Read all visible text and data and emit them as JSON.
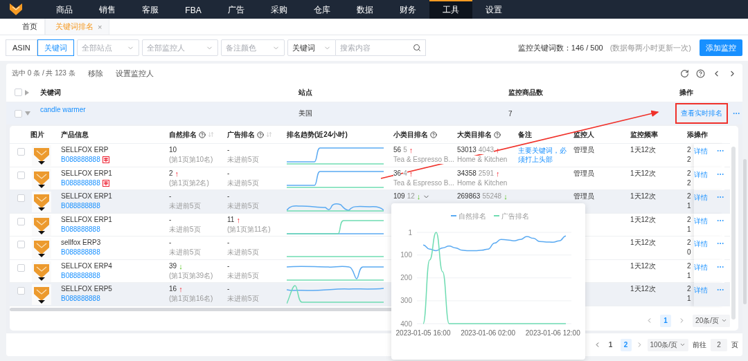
{
  "nav": {
    "items": [
      {
        "label": "商品",
        "selected": false
      },
      {
        "label": "销售",
        "selected": false
      },
      {
        "label": "客服",
        "selected": false
      },
      {
        "label": "FBA",
        "selected": false
      },
      {
        "label": "广告",
        "selected": false
      },
      {
        "label": "采购",
        "selected": false
      },
      {
        "label": "仓库",
        "selected": false
      },
      {
        "label": "数据",
        "selected": false
      },
      {
        "label": "财务",
        "selected": false
      },
      {
        "label": "工具",
        "selected": true
      },
      {
        "label": "设置",
        "selected": false
      }
    ]
  },
  "page_tabs": [
    {
      "label": "首页",
      "selected": false
    },
    {
      "label": "关键词排名",
      "selected": true,
      "close": "×"
    }
  ],
  "filters": {
    "mode_tabs": [
      {
        "label": "ASIN",
        "selected": false
      },
      {
        "label": "关键词",
        "selected": true
      }
    ],
    "selects": [
      {
        "placeholder": "全部站点"
      },
      {
        "placeholder": "全部监控人"
      },
      {
        "placeholder": "备注颜色"
      }
    ],
    "search_type": "关键词",
    "search": {
      "placeholder": "搜索内容"
    },
    "count_label": "监控关键词数：146 / 500",
    "update_note": "(数据每两小时更新一次)",
    "add_button": "添加监控"
  },
  "toolbar": {
    "selection": "选中 0 条 / 共 123 条",
    "actions": [
      "移除",
      "设置监控人"
    ]
  },
  "keyword_table": {
    "select_all": {
      "checked": false
    },
    "columns": [
      "关键词",
      "站点",
      "监控商品数",
      "操作"
    ],
    "rows": [
      {
        "checked": false,
        "keyword": "candle warmer",
        "site": "美国",
        "count": "7",
        "action": "查看实时排名",
        "expanded": true,
        "highlighted": true
      }
    ]
  },
  "product_table": {
    "columns": [
      {
        "label": "图片",
        "help": false,
        "sortable": false
      },
      {
        "label": "产品信息",
        "help": false,
        "sortable": false
      },
      {
        "label": "自然排名",
        "help": true,
        "sortable": true
      },
      {
        "label": "广告排名",
        "help": true,
        "sortable": true
      },
      {
        "label": "排名趋势(近24小时)",
        "help": false,
        "sortable": false
      },
      {
        "label": "小类目排名",
        "help": true,
        "sortable": false
      },
      {
        "label": "大类目排名",
        "help": true,
        "sortable": false
      },
      {
        "label": "备注",
        "help": false,
        "sortable": false
      },
      {
        "label": "监控人",
        "help": false,
        "sortable": false
      },
      {
        "label": "监控频率",
        "help": false,
        "sortable": false
      },
      {
        "label": "添"
      },
      {
        "label": "操作",
        "help": false,
        "sortable": false
      }
    ],
    "rows": [
      {
        "checked": false,
        "hovered": false,
        "name": "SELLFOX ERP",
        "asin": "B088888888",
        "stamped": true,
        "natural": {
          "value": "10",
          "note": "(第1页第10名)"
        },
        "ad": {
          "value": "-",
          "note": "未进前5页"
        },
        "small": {
          "rank": "56",
          "change": "5",
          "arrow": "↑",
          "rising": true,
          "category": "Tea & Espresso B..."
        },
        "big": {
          "rank": "53013",
          "change": "4043",
          "arrow": "↑",
          "rising": true,
          "category": "Home & Kitchen"
        },
        "note": "主要关键词，必须打上头部",
        "monitor": "管理员",
        "frequency": "1天12次",
        "added": [
          "2",
          "2"
        ],
        "action": "详情"
      },
      {
        "checked": false,
        "hovered": false,
        "name": "SELLFOX ERP1",
        "asin": "B088888888",
        "stamped": true,
        "natural": {
          "value": "2",
          "arrow": "↑",
          "rising": true,
          "note": "(第1页第2名)"
        },
        "ad": {
          "value": "-",
          "note": "未进前5页"
        },
        "small": {
          "rank": "36",
          "change": "4",
          "arrow": "↑",
          "rising": true,
          "category": "Tea & Espresso B..."
        },
        "big": {
          "rank": "34358",
          "change": "2591",
          "arrow": "↑",
          "rising": true,
          "category": "Home & Kitchen"
        },
        "monitor": "管理员",
        "frequency": "1天12次",
        "added": [
          "2",
          "2"
        ],
        "action": "详情"
      },
      {
        "checked": false,
        "hovered": true,
        "name": "SELLFOX ERP1",
        "asin": "B088888888",
        "stamped": false,
        "natural": {
          "value": "-",
          "note": "未进前5页"
        },
        "ad": {
          "value": "-",
          "note": "未进前5页"
        },
        "small": {
          "rank": "109",
          "change": "12",
          "arrow": "↓",
          "rising": false,
          "expandable": true
        },
        "big": {
          "rank": "269863",
          "change": "55248",
          "arrow": "↓",
          "rising": false
        },
        "monitor": "管理员",
        "frequency": "1天12次",
        "added": [
          "2",
          "1"
        ],
        "action": "详情"
      },
      {
        "checked": false,
        "hovered": false,
        "name": "SELLFOX ERP1",
        "asin": "B088888888",
        "stamped": false,
        "natural": {
          "value": "-",
          "note": "未进前5页"
        },
        "ad": {
          "value": "11",
          "arrow": "↑",
          "rising": true,
          "note": "(第1页第11名)"
        },
        "frequency": "1天12次",
        "added": [
          "2",
          "1"
        ],
        "action": "详情"
      },
      {
        "checked": false,
        "hovered": false,
        "name": "sellfox ERP3",
        "asin": "B088888888",
        "stamped": false,
        "natural": {
          "value": "-",
          "note": "未进前5页"
        },
        "ad": {
          "value": "-",
          "note": "未进前5页"
        },
        "frequency": "1天12次",
        "added": [
          "2",
          "0"
        ],
        "action": "详情"
      },
      {
        "checked": false,
        "hovered": false,
        "name": "SELLFOX ERP4",
        "asin": "B088888888",
        "stamped": false,
        "natural": {
          "value": "39",
          "arrow": "↓",
          "rising": false,
          "note": "(第1页第39名)"
        },
        "ad": {
          "value": "-",
          "note": "未进前5页"
        },
        "frequency": "1天12次",
        "added": [
          "2",
          "1"
        ],
        "action": "详情"
      },
      {
        "checked": false,
        "hovered": true,
        "name": "SELLFOX ERP5",
        "asin": "B088888888",
        "stamped": false,
        "natural": {
          "value": "16",
          "arrow": "↑",
          "rising": true,
          "note": "(第1页第16名)"
        },
        "ad": {
          "value": "-",
          "note": "未进前5页"
        },
        "frequency": "1天12次",
        "added": [
          "2",
          "1"
        ],
        "action": "详情"
      }
    ],
    "pagination": {
      "pages": [
        {
          "label": "1",
          "selected": true
        }
      ],
      "page_size": "20条/页"
    }
  },
  "chart_popover": {
    "chart_data": {
      "type": "line",
      "grid": true,
      "legend": "top",
      "categories": [
        "2023-01-05 16:00",
        null,
        null,
        null,
        null,
        null,
        null,
        null,
        null,
        null,
        "2023-01-06 02:00",
        null,
        null,
        null,
        null,
        null,
        null,
        null,
        null,
        null,
        "2023-01-06 12:00",
        null,
        null
      ],
      "ylim": [
        400,
        1
      ],
      "yticks": [
        1,
        100,
        200,
        300,
        400
      ],
      "series": [
        {
          "name": "自然排名",
          "color": "#5aaaf2",
          "values": [
            56,
            74,
            81,
            69,
            61,
            69,
            79,
            81,
            81,
            79,
            74,
            48,
            32,
            34,
            38,
            32,
            19,
            27,
            41,
            43,
            44,
            38,
            17
          ]
        },
        {
          "name": "广告排名",
          "color": "#6fdcb2",
          "values": [
            400,
            121,
            1,
            173,
            400,
            400,
            400,
            400,
            400,
            400,
            400,
            400,
            400,
            400,
            400,
            400,
            400,
            400,
            400,
            400,
            400,
            400,
            400
          ]
        }
      ]
    }
  },
  "pagination": {
    "pages": [
      {
        "label": "1",
        "selected": false
      },
      {
        "label": "2",
        "selected": true
      }
    ],
    "page_size": "100条/页",
    "goto_label": "前往",
    "goto_value": "2",
    "page_unit": "页"
  }
}
